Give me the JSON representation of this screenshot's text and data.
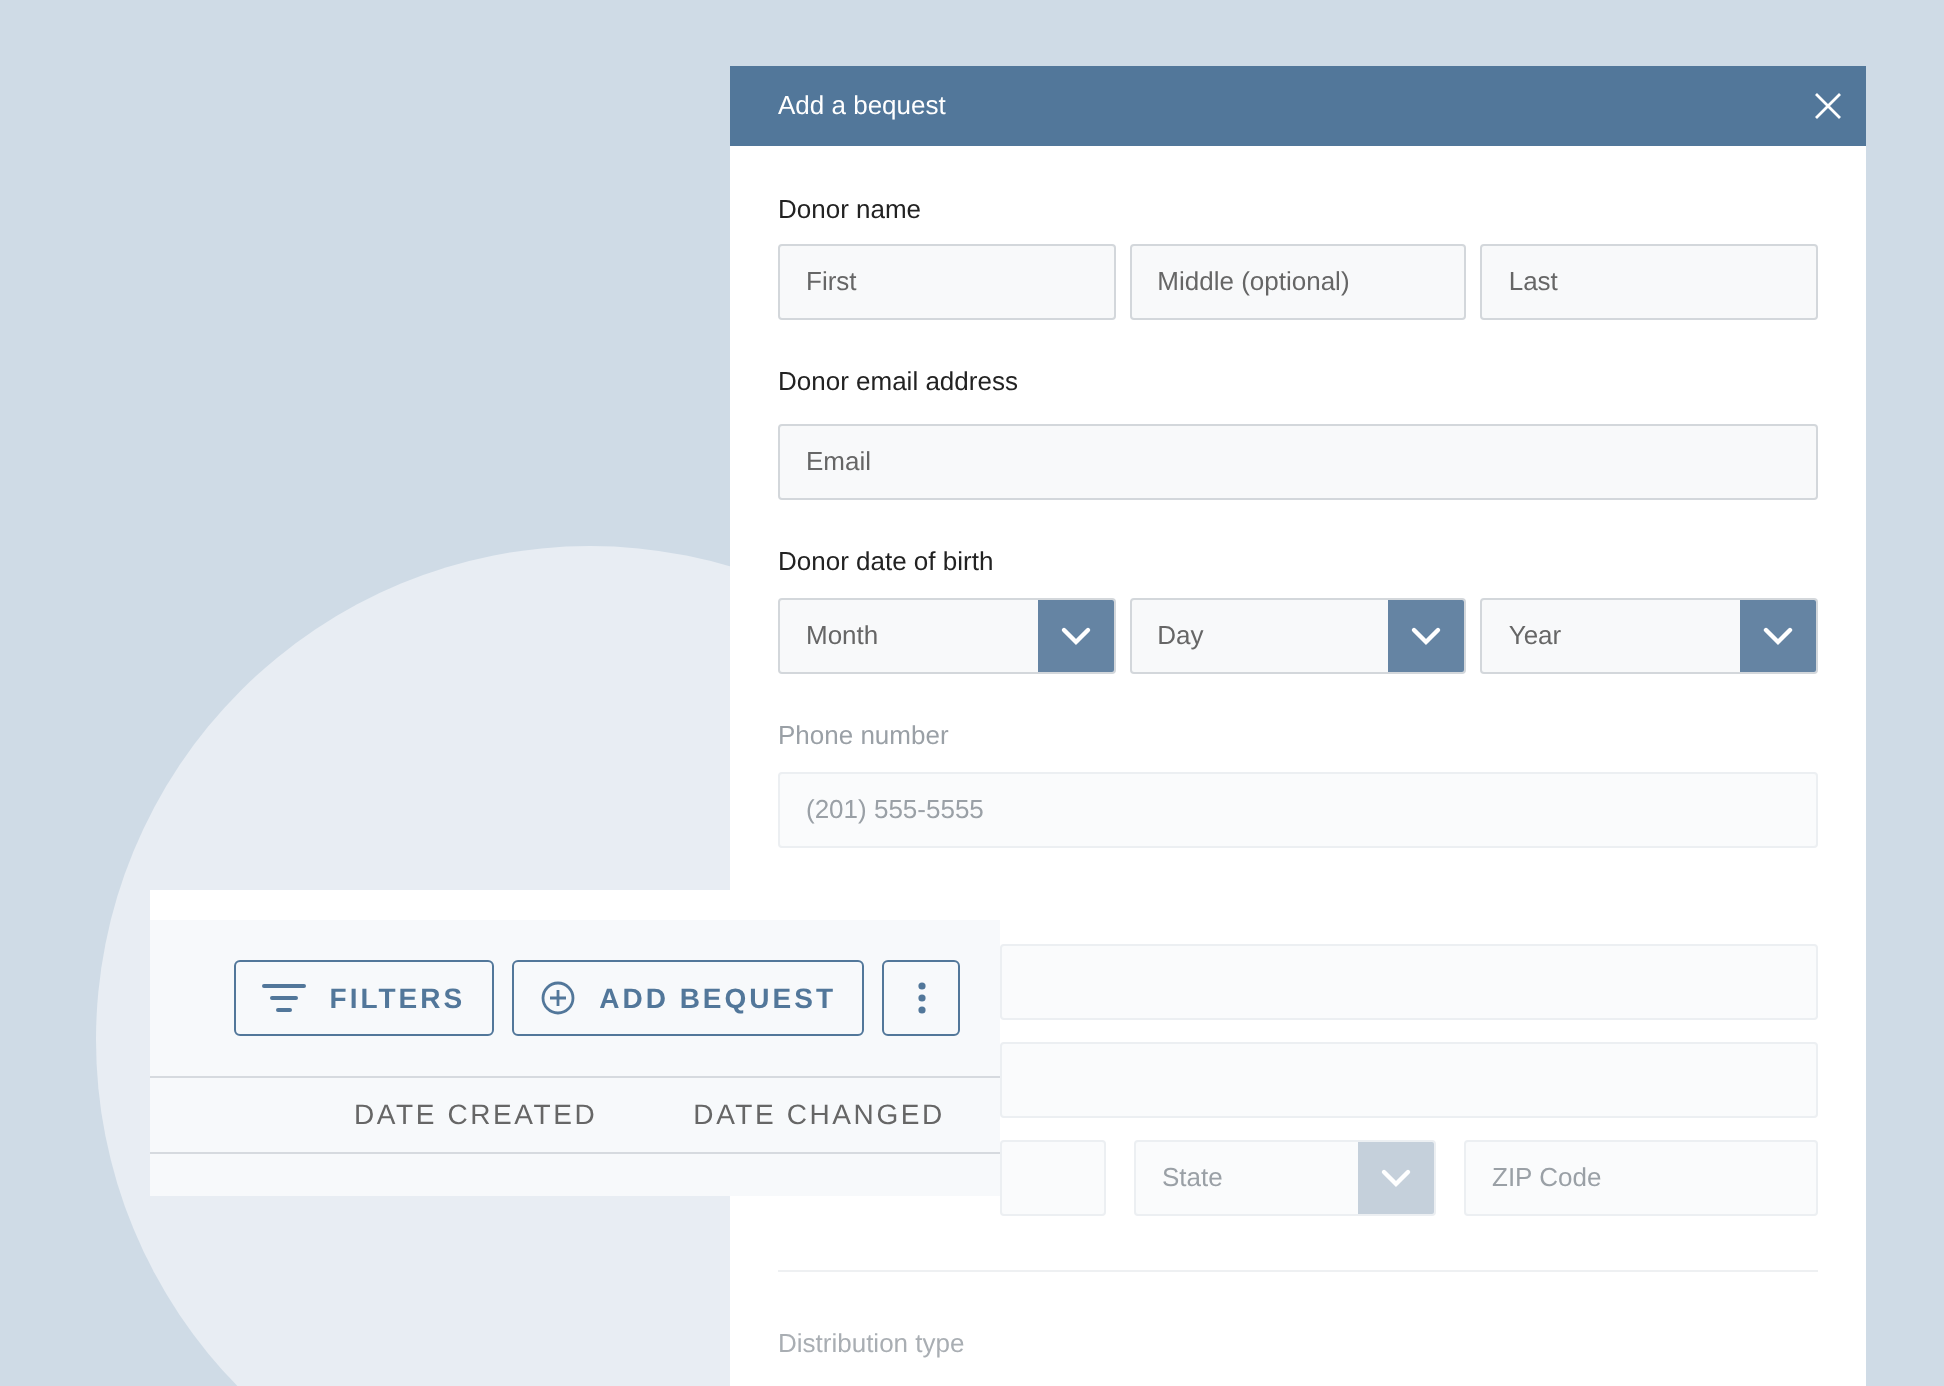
{
  "modal": {
    "title": "Add a bequest",
    "donor_name": {
      "label": "Donor name",
      "fields": [
        {
          "placeholder": "First"
        },
        {
          "placeholder": "Middle (optional)"
        },
        {
          "placeholder": "Last"
        }
      ]
    },
    "email": {
      "label": "Donor email address",
      "placeholder": "Email"
    },
    "birth_date": {
      "label": "Donor date of birth",
      "selects": [
        {
          "placeholder": "Month"
        },
        {
          "placeholder": "Day"
        },
        {
          "placeholder": "Year"
        }
      ]
    },
    "phone": {
      "label": "Phone number",
      "placeholder": "(201) 555-5555"
    },
    "location": {
      "fields": [
        {
          "kind": "input"
        },
        {
          "kind": "select",
          "placeholder": "State"
        },
        {
          "kind": "input",
          "placeholder": "ZIP Code"
        }
      ]
    },
    "distribution": {
      "label": "Distribution type"
    }
  },
  "table_card": {
    "toolbar": [
      {
        "kind": "filter",
        "label": "FILTERS"
      },
      {
        "kind": "add",
        "label": "ADD BEQUEST"
      },
      {
        "kind": "more"
      }
    ],
    "columns": [
      "DATE CREATED",
      "DATE CHANGED"
    ]
  }
}
